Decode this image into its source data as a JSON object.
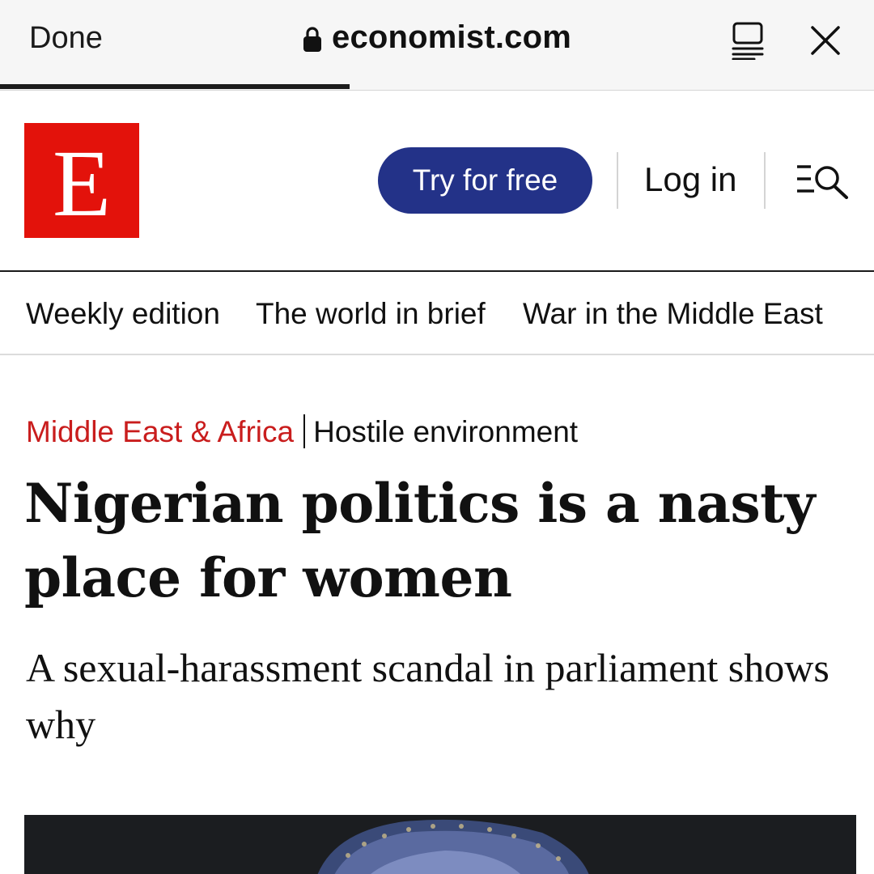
{
  "browser": {
    "done_label": "Done",
    "url": "economist.com",
    "page_load_progress": 0.4
  },
  "header": {
    "logo_letter": "E",
    "try_label": "Try for free",
    "login_label": "Log in"
  },
  "nav": {
    "items": [
      {
        "label": "Weekly edition"
      },
      {
        "label": "The world in brief"
      },
      {
        "label": "War in the Middle East"
      }
    ]
  },
  "article": {
    "section": "Middle East & Africa",
    "fly_title": "Hostile environment",
    "headline": "Nigerian politics is a nasty place for women",
    "standfirst": "A sexual-harassment scandal in parliament shows why"
  },
  "colors": {
    "brand_red": "#e3120b",
    "button_blue": "#233288",
    "rubric_red": "#c91d1d"
  },
  "icons": [
    "lock-icon",
    "reader-mode-icon",
    "close-icon",
    "menu-search-icon"
  ]
}
